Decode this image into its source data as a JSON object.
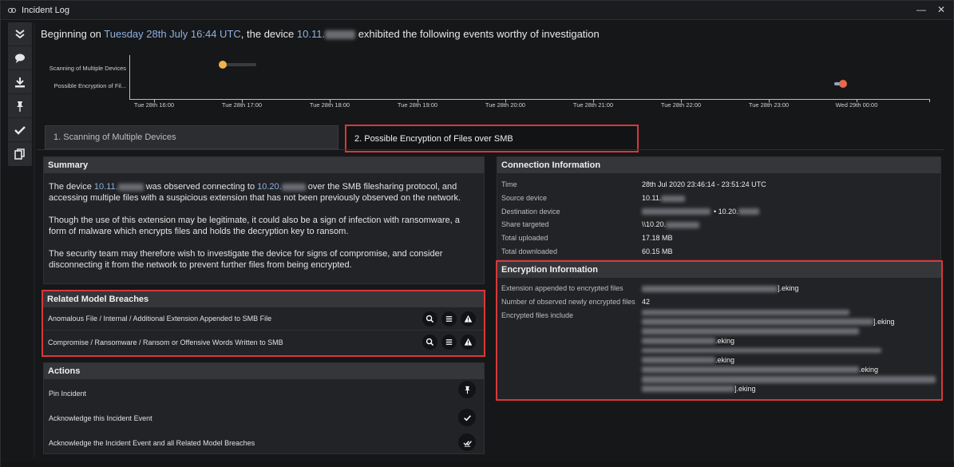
{
  "window": {
    "title": "Incident Log",
    "logo_icon": "darktrace-logo-icon",
    "minimize_glyph": "—",
    "close_glyph": "✕"
  },
  "sidebar": {
    "items": [
      {
        "name": "collapse-icon"
      },
      {
        "name": "comment-icon"
      },
      {
        "name": "download-icon"
      },
      {
        "name": "pin-icon"
      },
      {
        "name": "check-icon"
      },
      {
        "name": "copy-icon"
      }
    ]
  },
  "heading": {
    "prefix": "Beginning on ",
    "date": "Tuesday 28th July 16:44 UTC",
    "middle": ", the device ",
    "device": "10.11.",
    "suffix": " exhibited the following events worthy of investigation"
  },
  "timeline": {
    "rows": [
      {
        "label": "Scanning of Multiple Devices",
        "color": "#f0b34e"
      },
      {
        "label": "Possible Encryption of Fil...",
        "color": "#e8694a"
      }
    ],
    "ticks": [
      "Tue 28th 16:00",
      "Tue 28th 17:00",
      "Tue 28th 18:00",
      "Tue 28th 19:00",
      "Tue 28th 20:00",
      "Tue 28th 21:00",
      "Tue 28th 22:00",
      "Tue 28th 23:00",
      "Wed 29th 00:00"
    ]
  },
  "tabs": [
    {
      "label": "1. Scanning of Multiple Devices",
      "active": false
    },
    {
      "label": "2. Possible Encryption of Files over SMB",
      "active": true
    }
  ],
  "summary": {
    "title": "Summary",
    "p1_a": "The device ",
    "p1_dev1": "10.11.",
    "p1_b": " was observed connecting to ",
    "p1_dev2": "10.20.",
    "p1_c": " over the SMB filesharing protocol, and accessing multiple files with a suspicious extension that has not been previously observed on the network.",
    "p2": "Though the use of this extension may be legitimate, it could also be a sign of infection with ransomware, a form of malware which encrypts files and holds the decryption key to ransom.",
    "p3": "The security team may therefore wish to investigate the device for signs of compromise, and consider disconnecting it from the network to prevent further files from being encrypted."
  },
  "breaches": {
    "title": "Related Model Breaches",
    "rows": [
      {
        "label": "Anomalous File / Internal / Additional Extension Appended to SMB File"
      },
      {
        "label": "Compromise / Ransomware / Ransom or Offensive Words Written to SMB"
      }
    ]
  },
  "actions": {
    "title": "Actions",
    "rows": [
      {
        "label": "Pin Incident",
        "icon": "pin-icon"
      },
      {
        "label": "Acknowledge this Incident Event",
        "icon": "check-icon"
      },
      {
        "label": "Acknowledge the Incident Event and all Related Model Breaches",
        "icon": "double-check-icon"
      }
    ]
  },
  "connection": {
    "title": "Connection Information",
    "time_k": "Time",
    "time_v": "28th Jul 2020 23:46:14 - 23:51:24 UTC",
    "src_k": "Source device",
    "src_v": "10.11.",
    "dst_k": "Destination device",
    "dst_v": "• 10.20.",
    "share_k": "Share targeted",
    "share_v": "\\\\10.20.",
    "up_k": "Total uploaded",
    "up_v": "17.18 MB",
    "down_k": "Total downloaded",
    "down_v": "60.15 MB"
  },
  "encryption": {
    "title": "Encryption Information",
    "ext_k": "Extension appended to encrypted files",
    "ext_v": "].eking",
    "num_k": "Number of observed newly encrypted files",
    "num_v": "42",
    "files_k": "Encrypted files include",
    "file_suffix_1": "].eking",
    "file_suffix_2": ".eking",
    "file_suffix_3": ".eking",
    "file_suffix_4": ".eking",
    "file_suffix_5": "].eking"
  }
}
